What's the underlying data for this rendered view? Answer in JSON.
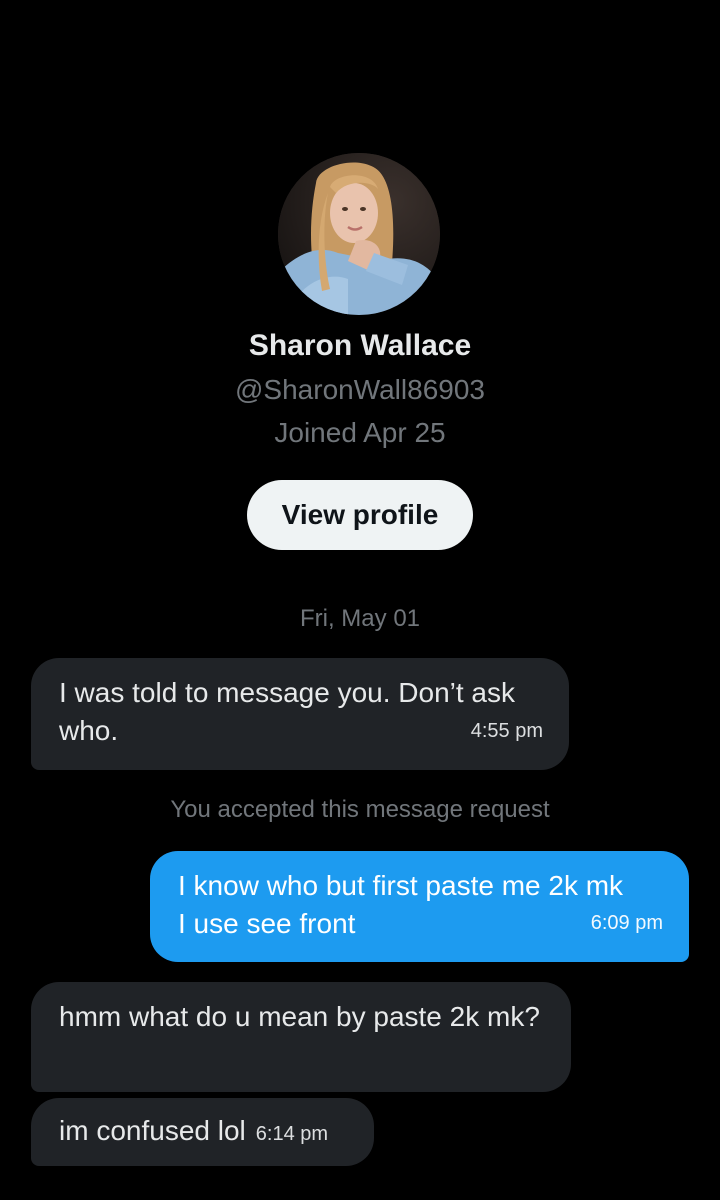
{
  "profile": {
    "name": "Sharon Wallace",
    "handle": "@SharonWall86903",
    "joined": "Joined Apr 25",
    "view_profile_label": "View profile"
  },
  "conversation": {
    "date_separator": "Fri, May 01",
    "system_notice": "You accepted this message request",
    "messages": [
      {
        "direction": "incoming",
        "text": "I was told to message you. Don’t ask who.",
        "time": "4:55 pm"
      },
      {
        "direction": "outgoing",
        "text_line1": "I know who but first paste me 2k mk",
        "text_line2": "I use see front",
        "time": "6:09 pm"
      },
      {
        "direction": "incoming",
        "text": "hmm what do u mean by paste 2k mk?",
        "time": ""
      },
      {
        "direction": "incoming",
        "text": "im confused lol",
        "time": "6:14 pm"
      }
    ]
  },
  "colors": {
    "background": "#000000",
    "incoming_bubble": "#202327",
    "outgoing_bubble": "#1d9bf0",
    "muted_text": "#71767b"
  }
}
